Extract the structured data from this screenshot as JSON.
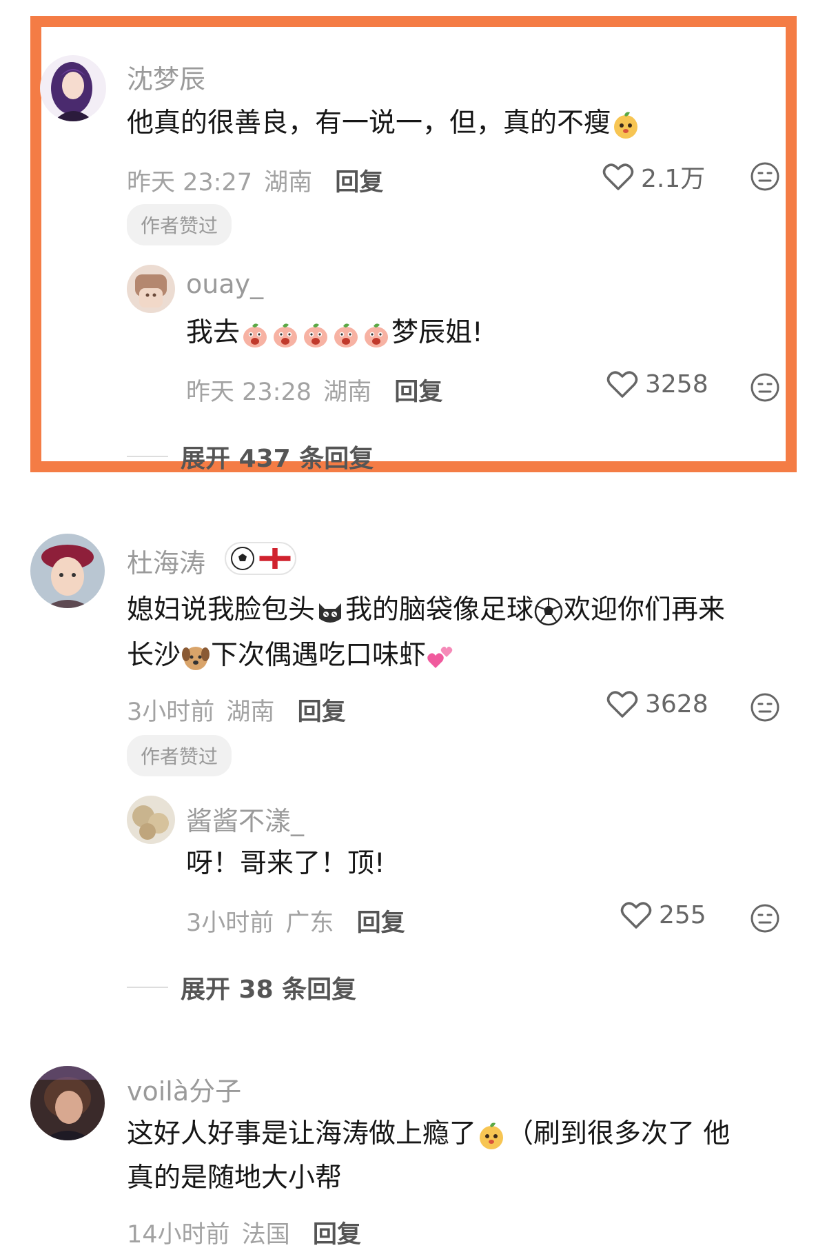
{
  "comments": [
    {
      "username": "沈梦辰",
      "text": "他真的很善良，有一说一，但，真的不瘦",
      "time": "昨天 23:27",
      "location": "湖南",
      "reply_label": "回复",
      "likes": "2.1万",
      "badge": "作者赞过",
      "replies": [
        {
          "username": "ouay_",
          "text_before": "我去",
          "text_after": "梦辰姐!",
          "time": "昨天 23:28",
          "location": "湖南",
          "reply_label": "回复",
          "likes": "3258"
        }
      ],
      "expand_label": "展开 437 条回复"
    },
    {
      "username": "杜海涛",
      "line1_part1": "媳妇说我脸包头",
      "line1_part2": "我的脑袋像足球",
      "line1_part3": "欢迎你们再来",
      "line2_part1": "长沙",
      "line2_part2": "下次偶遇吃口味虾",
      "time": "3小时前",
      "location": "湖南",
      "reply_label": "回复",
      "likes": "3628",
      "badge": "作者赞过",
      "replies": [
        {
          "username": "酱酱不漾_",
          "text": "呀！哥来了！顶!",
          "time": "3小时前",
          "location": "广东",
          "reply_label": "回复",
          "likes": "255"
        }
      ],
      "expand_label": "展开 38 条回复"
    },
    {
      "username": "voilà分子",
      "line1_part1": "这好人好事是让海涛做上瘾了",
      "line1_part2": "（刷到很多次了 他",
      "line2": "真的是随地大小帮",
      "time": "14小时前",
      "location": "法国",
      "reply_label": "回复"
    }
  ],
  "icons": {
    "like": "heart-outline-icon",
    "dislike": "neutral-face-icon",
    "emoji_orange": "orange-face-emoji",
    "emoji_peach": "peach-face-emoji",
    "emoji_cat": "cat-face-emoji",
    "emoji_soccer": "soccer-ball-emoji",
    "emoji_dog": "dog-face-emoji",
    "emoji_hearts": "two-hearts-emoji",
    "flag": "england-flag-icon"
  },
  "colors": {
    "highlight_border": "#f47c45",
    "username": "#9a9a9a",
    "meta": "#a2a2a2"
  }
}
